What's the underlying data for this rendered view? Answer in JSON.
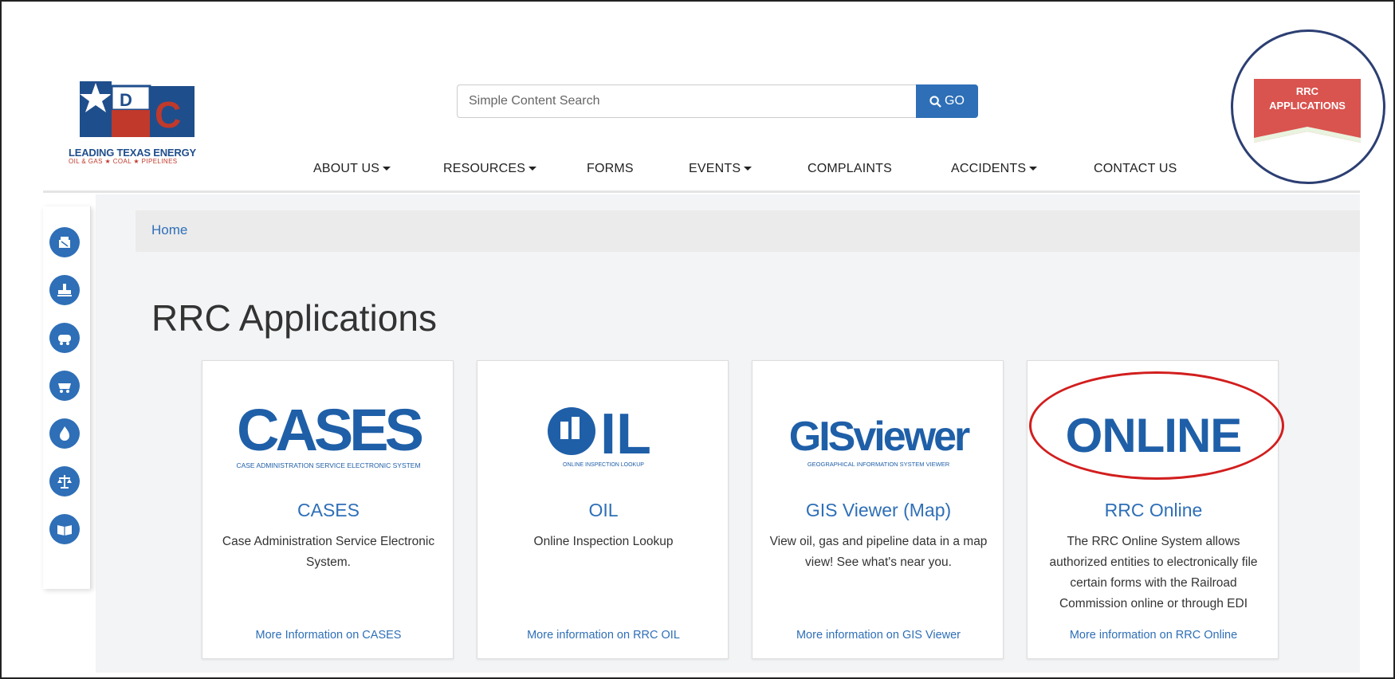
{
  "header": {
    "logo_letters": "RRC",
    "logo_tagline": "LEADING TEXAS ENERGY",
    "logo_sub": "OIL & GAS ★ COAL ★ PIPELINES",
    "search": {
      "placeholder": "Simple Content Search",
      "button_label": "GO"
    },
    "nav": [
      {
        "label": "ABOUT US",
        "dropdown": true
      },
      {
        "label": "RESOURCES",
        "dropdown": true
      },
      {
        "label": "FORMS",
        "dropdown": false
      },
      {
        "label": "EVENTS",
        "dropdown": true
      },
      {
        "label": "COMPLAINTS",
        "dropdown": false
      },
      {
        "label": "ACCIDENTS",
        "dropdown": true
      },
      {
        "label": "CONTACT US",
        "dropdown": false
      }
    ],
    "apps_button": {
      "line1": "RRC",
      "line2": "APPLICATIONS"
    }
  },
  "sidebar": {
    "icons": [
      "oil-pump-icon",
      "pipeline-icon",
      "tank-icon",
      "coal-cart-icon",
      "flame-icon",
      "scales-icon",
      "book-icon"
    ]
  },
  "breadcrumb": {
    "home": "Home"
  },
  "page": {
    "title": "RRC Applications"
  },
  "cards": [
    {
      "logo_text": "CASES",
      "logo_caption": "CASE ADMINISTRATION SERVICE ELECTRONIC SYSTEM",
      "title": "CASES",
      "description": "Case Administration Service Electronic System.",
      "link": "More Information on CASES"
    },
    {
      "logo_text": "IL",
      "logo_caption": "ONLINE INSPECTION LOOKUP",
      "title": "OIL",
      "description": "Online Inspection Lookup",
      "link": "More information on RRC OIL"
    },
    {
      "logo_text": "GISviewer",
      "logo_caption": "GEOGRAPHICAL INFORMATION SYSTEM VIEWER",
      "title": "GIS Viewer (Map)",
      "description": "View oil, gas and pipeline data in a map view! See what's near you.",
      "link": "More information on GIS Viewer"
    },
    {
      "logo_text": "ONLINE",
      "logo_caption": "",
      "title": "RRC Online",
      "description": "The RRC Online System allows authorized entities to electronically file certain forms with the Railroad Commission online or through EDI",
      "link": "More information on RRC Online"
    }
  ],
  "colors": {
    "brand_blue": "#2e6fb7",
    "logo_navy": "#1f4e8c",
    "apps_red": "#d9534f",
    "annotation_red": "#d21e1e",
    "annotation_navy": "#2c3f73"
  }
}
